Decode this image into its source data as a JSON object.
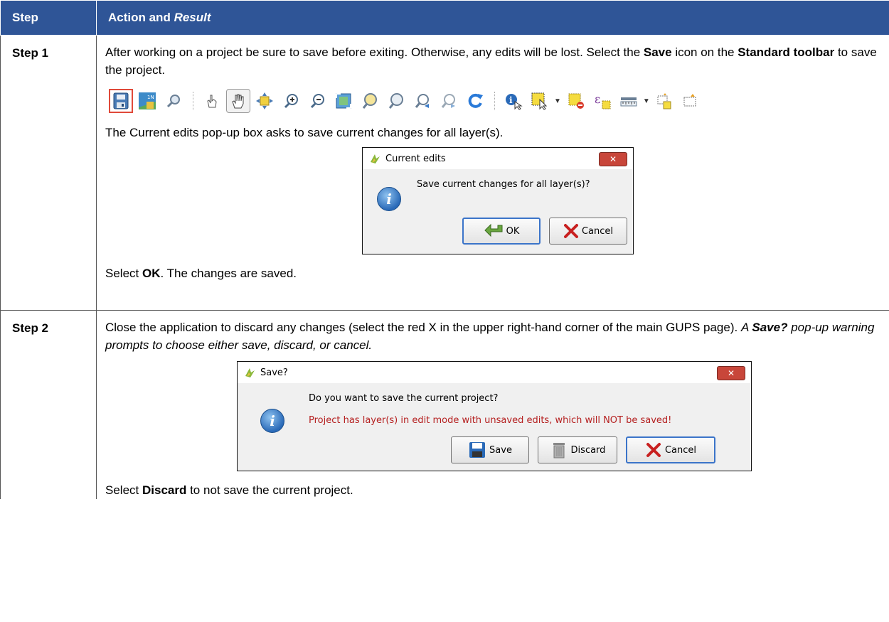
{
  "table": {
    "header": {
      "step": "Step",
      "action": "Action and ",
      "result": "Result"
    },
    "rows": [
      {
        "step": "Step 1",
        "intro": {
          "a": "After working on a project be sure to save before exiting. Otherwise, any edits will be lost. Select the ",
          "save": "Save",
          "b": " icon on the ",
          "toolbar": "Standard toolbar",
          "c": " to save the project."
        },
        "popup_text": "The Current edits pop-up box asks to save current changes for all layer(s).",
        "outro": {
          "a": "Select ",
          "ok": "OK",
          "b": ". The changes are saved."
        }
      },
      {
        "step": "Step 2",
        "intro": {
          "a": "Close the application to discard any changes (select the red X in the upper right-hand corner of the main GUPS page). ",
          "b": "A ",
          "save": "Save?",
          "c": " pop-up warning prompts to choose either save, discard, or cancel."
        },
        "outro": {
          "a": "Select ",
          "discard": "Discard",
          "b": " to not save the current project."
        }
      }
    ]
  },
  "dialog_current_edits": {
    "title": "Current edits",
    "close": "✕",
    "message": "Save current changes for all layer(s)?",
    "ok": "OK",
    "cancel": "Cancel"
  },
  "dialog_save": {
    "title": "Save?",
    "close": "✕",
    "message": "Do you want to save the current project?",
    "warning": "Project has layer(s) in edit mode with unsaved edits, which will NOT be saved!",
    "save": "Save",
    "discard": "Discard",
    "cancel": "Cancel"
  },
  "toolbar_icons": [
    "save-project-icon",
    "new-print-layout-icon",
    "composer-manager-icon",
    "touch-zoom-pan-icon",
    "pan-map-icon",
    "pan-to-selection-icon",
    "zoom-in-icon",
    "zoom-out-icon",
    "zoom-full-icon",
    "zoom-to-selection-icon",
    "zoom-to-layer-icon",
    "zoom-last-icon",
    "zoom-next-icon",
    "refresh-icon",
    "identify-features-icon",
    "select-features-icon",
    "deselect-all-icon",
    "select-by-expression-icon",
    "measure-line-icon",
    "new-annotation-icon",
    "text-annotation-icon"
  ],
  "colors": {
    "header_bg": "#2f5597",
    "highlight": "#e04a3a",
    "warning_text": "#b52020"
  }
}
